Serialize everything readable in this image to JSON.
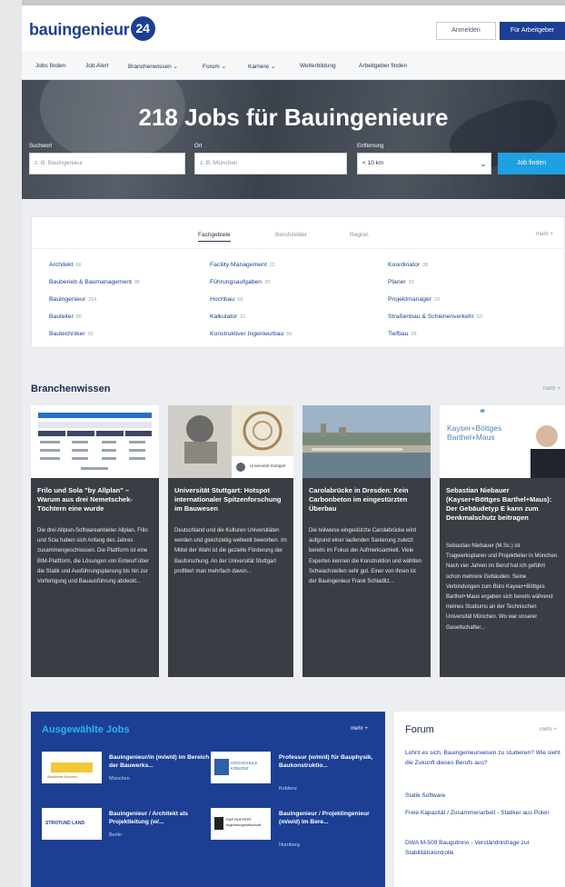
{
  "header": {
    "logo_text": "bauingenieur",
    "logo_badge": "24",
    "login_label": "Anmelden",
    "employer_label": "Für Arbeitgeber"
  },
  "nav": {
    "items": [
      "Jobs finden",
      "Job Alert",
      "Branchenwissen ⌄",
      "Forum ⌄",
      "Karriere ⌄",
      "Weiterbildung",
      "Arbeitgeber finden"
    ]
  },
  "hero": {
    "title": "218 Jobs für Bauingenieure",
    "keyword_label": "Suchwort",
    "keyword_placeholder": "z. B. Bauingenieur",
    "location_label": "Ort",
    "location_placeholder": "z. B. München",
    "radius_label": "Entfernung",
    "radius_value": "< 10 km",
    "search_label": "Job finden"
  },
  "categories": {
    "tabs": [
      "Fachgebiete",
      "Berufsfelder",
      "Region"
    ],
    "more": "mehr +",
    "col1": [
      {
        "name": "Architekt",
        "count": "66"
      },
      {
        "name": "Bauberieb & Baumanagement",
        "count": "85"
      },
      {
        "name": "Bauingenieur",
        "count": "214"
      },
      {
        "name": "Bauleiter",
        "count": "85"
      },
      {
        "name": "Bautechniker",
        "count": "65"
      }
    ],
    "col2": [
      {
        "name": "Facility Management",
        "count": "22"
      },
      {
        "name": "Führungsaufgaben",
        "count": "30"
      },
      {
        "name": "Hochbau",
        "count": "58"
      },
      {
        "name": "Kalkulator",
        "count": "21"
      },
      {
        "name": "Konstruktiver Ingenieurbau",
        "count": "56"
      }
    ],
    "col3": [
      {
        "name": "Koordinator",
        "count": "38"
      },
      {
        "name": "Planer",
        "count": "39"
      },
      {
        "name": "Projektmanager",
        "count": "23"
      },
      {
        "name": "Straßenbau & Schienenverkehr",
        "count": "53"
      },
      {
        "name": "Tiefbau",
        "count": "28"
      }
    ]
  },
  "branchenwissen": {
    "title": "Branchenwissen",
    "more": "mehr +",
    "articles": [
      {
        "title": "Frilo und Sola \"by Allplan\" – Warum aus drei Nemetschek-Töchtern eine wurde",
        "text": "Die drei Allplan-Softwareanbieter Allplan, Frilo und Scia haben sich Anfang des Jahres zusammengeschlossen. Die Plattform ist eine BIM-Plattform, die Lösungen von Entwurf über die Statik und Ausführungsplanung bis hin zur Vorfertigung und Bauausführung abdeckt..."
      },
      {
        "title": "Universität Stuttgart: Hotspot internationaler Spitzenforschung im Bauwesen",
        "text": "Deutschland und die Kulturen Universitäten werden und gleichzeitig weltweit beworben. Im Mittel der Wahl ist die gezielte Förderung der Bauforschung. An der Universität Stuttgart profitiert man mehrfach davon...",
        "logo": "Universität Stuttgart"
      },
      {
        "title": "Carolabrücke in Dresden: Kein Carbonbeton im eingestürzten Überbau",
        "text": "Die teilweise eingestürzte Carolabrücke wird aufgrund einer laufenden Sanierung zuletzt bereits im Fokus der Aufmerksamkeit. Viele Experten kennen die Konstruktion und wählten Schwachstellen sehr gut. Einer von ihnen ist der Bauingenieur Frank Schladitz..."
      },
      {
        "title": "Sebastian Niebauer (Kayser+Böttges Barthel+Maus): Der Gebäudetyp E kann zum Denkmalschutz beitragen",
        "text": "Sebastian Niebauer (M.Sc.) ist Tragwerksplaner und Projektleiter in München. Nach vier Jahren im Beruf hat ich geführt schon mehrere Gebäuden. Seine Verbindungen zum Büro Kayser+Böttges Barthel+Maus ergaben sich bereits während meines Studiums an der Technischen Universität München. Wo war unserer Gesellschafter...",
        "logo_line1": "Kayser+Böttges",
        "logo_line2": "Barthel+Maus"
      }
    ]
  },
  "jobs": {
    "title": "Ausgewählte Jobs",
    "more": "mehr +",
    "items": [
      {
        "title": "Bauingenieur/in (m/w/d) im Bereich der Bauwerks...",
        "location": "München",
        "logo": "Stadtwerke München"
      },
      {
        "title": "Professur (w/m/d) für Bauphysik, Baukonstruktio...",
        "location": "Koblenz",
        "logo": "HOCHSCHULE KOBLENZ"
      },
      {
        "title": "Bauingenieur / Architekt als Projektleitung (w/...",
        "location": "Berlin",
        "logo": "STROTUND LAND"
      },
      {
        "title": "Bauingenieur / Projektingenieur (m/w/d) im Bere...",
        "location": "Nürnberg",
        "logo": "R&P RUFFERT Ingenieurgesellschaft"
      }
    ]
  },
  "forum": {
    "title": "Forum",
    "more": "mehr +",
    "items": [
      "Lohnt es sich, Bauingenieurwesen zu studieren? Wie sieht die Zukunft dieses Berufs aus?",
      "Statik Software",
      "Freie Kapazität / Zusammenarbeit - Statiker aus Polen",
      "DWA M-509 Baugutinno - Verständnisfrage zur Stabilitätskontrolle"
    ]
  }
}
